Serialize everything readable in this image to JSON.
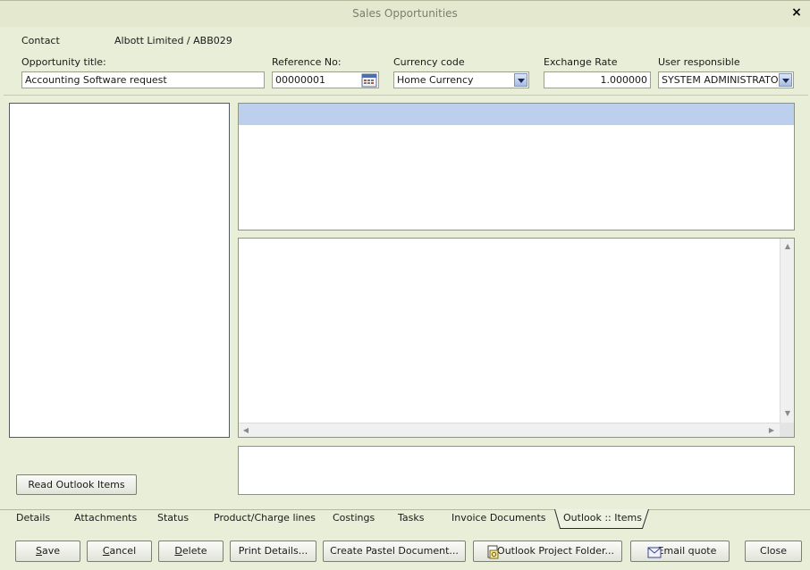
{
  "window": {
    "title": "Sales Opportunities",
    "close_glyph": "×"
  },
  "contact": {
    "label": "Contact",
    "value": "Albott Limited / ABB029"
  },
  "form": {
    "opportunity_title_label": "Opportunity title:",
    "opportunity_title_value": "Accounting Software request",
    "reference_label": "Reference No:",
    "reference_value": "00000001",
    "currency_label": "Currency code",
    "currency_value": "Home Currency",
    "exchange_rate_label": "Exchange Rate",
    "exchange_rate_value": "1.000000",
    "user_label": "User responsible",
    "user_value": "SYSTEM ADMINISTRATOR"
  },
  "panels": {
    "read_outlook_items_label": "Read Outlook Items"
  },
  "tabs": [
    "Details",
    "Attachments",
    "Status",
    "Product/Charge lines",
    "Costings",
    "Tasks",
    "Invoice Documents",
    "Outlook :: Items"
  ],
  "active_tab": "Outlook :: Items",
  "buttons": {
    "save": {
      "mnemonic": "S",
      "rest": "ave"
    },
    "cancel": {
      "mnemonic": "C",
      "rest": "ancel"
    },
    "delete": {
      "mnemonic": "D",
      "rest": "elete"
    },
    "print_details": "Print Details...",
    "create_pastel": "Create Pastel Document...",
    "outlook_folder": "Outlook Project Folder...",
    "email_quote": "Email quote",
    "close": "Close"
  },
  "icons": {
    "calendar": "calendar-icon",
    "folder": "outlook-folder-icon",
    "email": "envelope-icon"
  },
  "colors": {
    "background": "#e9eed9",
    "grid_header": "#bcd0ee",
    "title_text": "#7a7f6a"
  }
}
